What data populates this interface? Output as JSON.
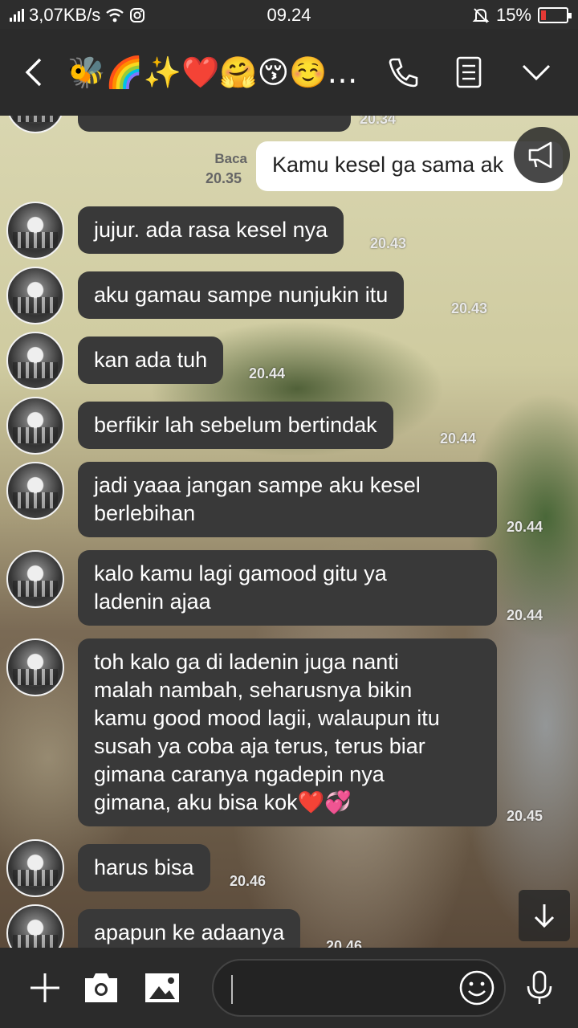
{
  "status_bar": {
    "network_speed": "3,07KB/s",
    "time": "09.24",
    "battery": "15%",
    "battery_level": 0.15
  },
  "header": {
    "title": "🐝🌈✨❤️🤗😚☺️…",
    "icons": [
      "back-icon",
      "phone-icon",
      "notes-icon",
      "chevron-down-icon"
    ]
  },
  "messages": [
    {
      "id": "m0",
      "dir": "in",
      "text": "",
      "time": "20.34"
    },
    {
      "id": "m1",
      "dir": "out",
      "text": "Kamu kesel ga sama ak",
      "read": "Baca",
      "time": "20.35"
    },
    {
      "id": "m2",
      "dir": "in",
      "text": "jujur. ada rasa kesel nya",
      "time": "20.43"
    },
    {
      "id": "m3",
      "dir": "in",
      "text": "aku gamau sampe nunjukin itu",
      "time": "20.43"
    },
    {
      "id": "m4",
      "dir": "in",
      "text": "kan ada tuh",
      "time": "20.44"
    },
    {
      "id": "m5",
      "dir": "in",
      "text": "berfikir lah sebelum bertindak",
      "time": "20.44"
    },
    {
      "id": "m6",
      "dir": "in",
      "lines": [
        "jadi yaaa jangan sampe aku kesel",
        "berlebihan"
      ],
      "time": "20.44"
    },
    {
      "id": "m7",
      "dir": "in",
      "lines": [
        "kalo kamu lagi gamood gitu ya",
        "ladenin ajaa"
      ],
      "time": "20.44"
    },
    {
      "id": "m8",
      "dir": "in",
      "lines": [
        "toh kalo ga di ladenin juga nanti",
        "malah nambah, seharusnya bikin",
        "kamu good mood lagii, walaupun itu",
        "susah ya coba aja terus, terus biar",
        "gimana caranya ngadepin nya",
        "gimana, aku bisa kok❤️💞"
      ],
      "time": "20.45"
    },
    {
      "id": "m9",
      "dir": "in",
      "text": "harus bisa",
      "time": "20.46"
    },
    {
      "id": "m10",
      "dir": "in",
      "text": "apapun ke adaanya",
      "time": "20.46"
    }
  ],
  "buttons": {
    "announce": "megaphone-icon",
    "scroll_down": "arrow-down-icon"
  },
  "bottom_bar": {
    "icons": [
      "plus-icon",
      "camera-icon",
      "image-icon",
      "emoji-icon",
      "microphone-icon"
    ],
    "input_value": ""
  }
}
